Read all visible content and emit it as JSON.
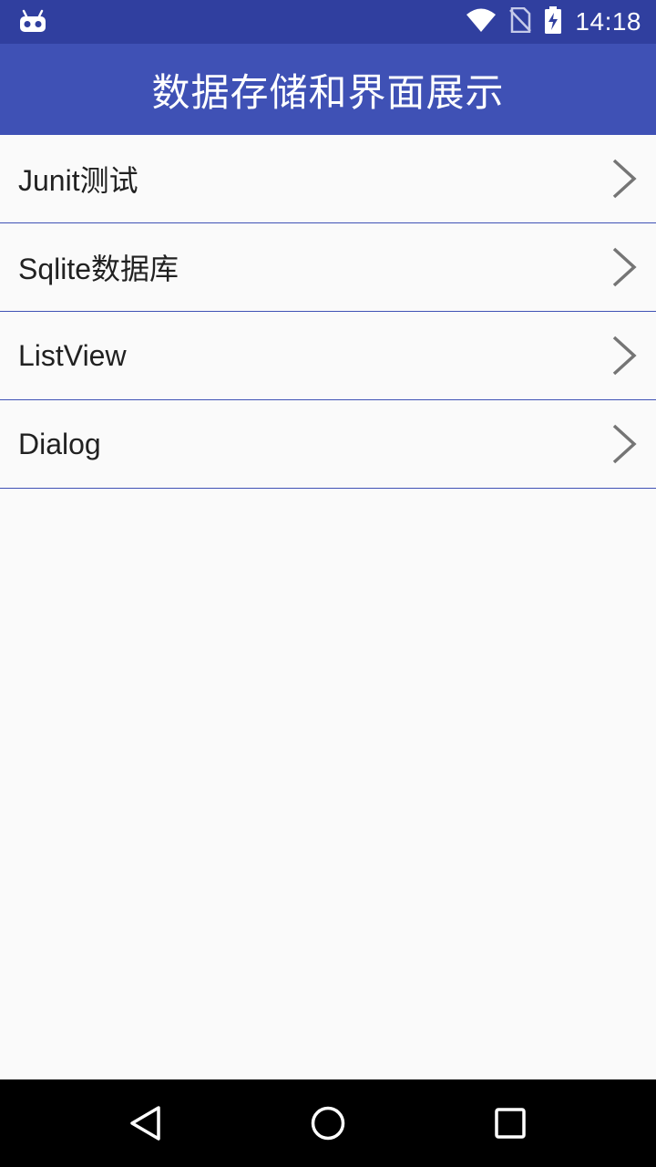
{
  "status_bar": {
    "time": "14:18",
    "icons": [
      "android-debug-icon",
      "wifi-icon",
      "no-sim-icon",
      "battery-charging-icon"
    ]
  },
  "app_bar": {
    "title": "数据存储和界面展示"
  },
  "menu": {
    "items": [
      {
        "label": "Junit测试",
        "icon": "chevron-right-icon"
      },
      {
        "label": "Sqlite数据库",
        "icon": "chevron-right-icon"
      },
      {
        "label": "ListView",
        "icon": "chevron-right-icon"
      },
      {
        "label": "Dialog",
        "icon": "chevron-right-icon"
      }
    ]
  },
  "nav_bar": {
    "buttons": [
      "back-icon",
      "home-icon",
      "recents-icon"
    ]
  },
  "colors": {
    "status_bar": "#303f9f",
    "app_bar": "#3f51b5",
    "divider": "#3f51b5",
    "background": "#fafafa",
    "text": "#212121",
    "chevron": "#757575"
  }
}
